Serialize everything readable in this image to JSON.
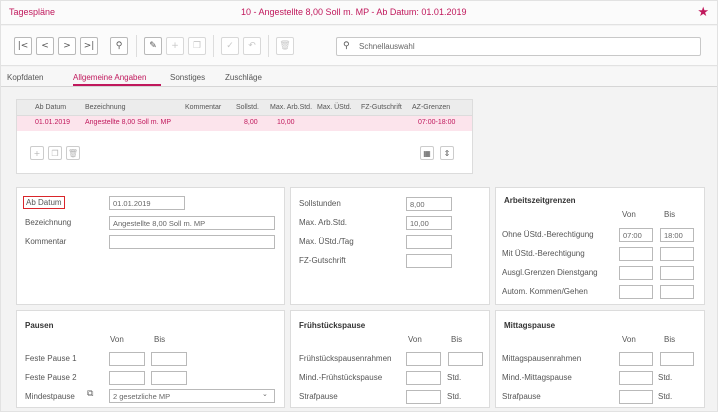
{
  "title": {
    "left": "Tagespläne",
    "center": "10 - Angestellte 8,00 Soll m. MP - Ab Datum: 01.01.2019"
  },
  "toolbar": {
    "nav": [
      "|<",
      "<",
      ">",
      ">|"
    ],
    "search_placeholder": "Schnellauswahl"
  },
  "tabs": [
    "Kopfdaten",
    "Allgemeine Angaben",
    "Sonstiges",
    "Zuschläge"
  ],
  "grid": {
    "columns": [
      "Ab Datum",
      "Bezeichnung",
      "Kommentar",
      "Sollstd.",
      "Max. Arb.Std.",
      "Max. ÜStd.",
      "FZ-Gutschrift",
      "AZ-Grenzen"
    ],
    "row": {
      "ab_datum": "01.01.2019",
      "bezeichnung": "Angestellte 8,00 Soll m. MP",
      "sollstd": "8,00",
      "max_arb": "10,00",
      "az_grenzen": "07:00-18:00"
    }
  },
  "allgemein": {
    "ab_datum_label": "Ab Datum",
    "ab_datum": "01.01.2019",
    "bezeichnung_label": "Bezeichnung",
    "bezeichnung": "Angestellte 8,00 Soll m. MP",
    "kommentar_label": "Kommentar"
  },
  "stunden": {
    "sollstunden_label": "Sollstunden",
    "sollstunden": "8,00",
    "max_arb_label": "Max. Arb.Std.",
    "max_arb": "10,00",
    "max_ustd_label": "Max. ÜStd./Tag",
    "fz_label": "FZ-Gutschrift"
  },
  "az_grenzen": {
    "title": "Arbeitszeitgrenzen",
    "von": "Von",
    "bis": "Bis",
    "rows": [
      {
        "label": "Ohne ÜStd.-Berechtigung",
        "von": "07:00",
        "bis": "18:00"
      },
      {
        "label": "Mit ÜStd.-Berechtigung"
      },
      {
        "label": "Ausgl.Grenzen Dienstgang"
      },
      {
        "label": "Autom. Kommen/Gehen"
      }
    ]
  },
  "pausen": {
    "title": "Pausen",
    "von": "Von",
    "bis": "Bis",
    "feste1": "Feste Pause 1",
    "feste2": "Feste Pause 2",
    "mindest_label": "Mindestpause",
    "mindest_value": "2 gesetzliche MP"
  },
  "fruehstueck": {
    "title": "Frühstückspause",
    "von": "Von",
    "bis": "Bis",
    "rahmen": "Frühstückspausenrahmen",
    "mind": "Mind.-Frühstückspause",
    "straf": "Strafpause",
    "std": "Std."
  },
  "mittag": {
    "title": "Mittagspause",
    "von": "Von",
    "bis": "Bis",
    "rahmen": "Mittagspausenrahmen",
    "mind": "Mind.-Mittagspause",
    "straf": "Strafpause",
    "std": "Std."
  }
}
